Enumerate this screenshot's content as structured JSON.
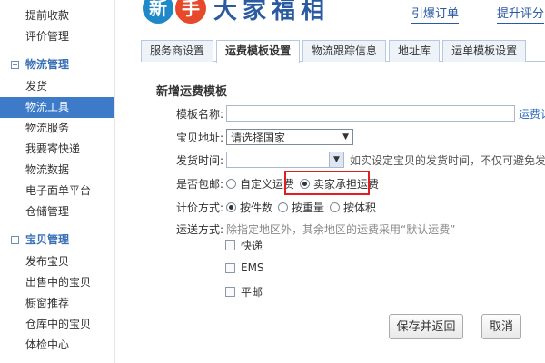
{
  "sidebar": {
    "top_items": [
      {
        "label": "提前收款"
      },
      {
        "label": "评价管理"
      }
    ],
    "groups": [
      {
        "title": "物流管理",
        "items": [
          {
            "label": "发货"
          },
          {
            "label": "物流工具",
            "active": true
          },
          {
            "label": "物流服务"
          },
          {
            "label": "我要寄快递"
          },
          {
            "label": "物流数据"
          },
          {
            "label": "电子面单平台"
          },
          {
            "label": "仓储管理"
          }
        ]
      },
      {
        "title": "宝贝管理",
        "items": [
          {
            "label": "发布宝贝"
          },
          {
            "label": "出售中的宝贝"
          },
          {
            "label": "橱窗推荐"
          },
          {
            "label": "仓库中的宝贝"
          },
          {
            "label": "体检中心"
          }
        ]
      }
    ]
  },
  "header": {
    "logo_badge_1": "新",
    "logo_badge_2": "手",
    "logo_text": "大家福相",
    "link_1": "引爆订单",
    "link_2": "提升评分"
  },
  "tabs": [
    {
      "label": "服务商设置",
      "active": false
    },
    {
      "label": "运费模板设置",
      "active": true
    },
    {
      "label": "物流跟踪信息",
      "active": false
    },
    {
      "label": "地址库",
      "active": false
    },
    {
      "label": "运单模板设置",
      "active": false
    }
  ],
  "form": {
    "title": "新增运费模板",
    "name_label": "模板名称:",
    "name_value": "",
    "name_link": "运费计",
    "address_label": "宝贝地址:",
    "address_value": "请选择国家",
    "ship_time_label": "发货时间:",
    "ship_time_value": "",
    "ship_time_hint": "如实设定宝贝的发货时间，不仅可避免发货咨",
    "free_ship_label": "是否包邮:",
    "free_ship_opt_custom": "自定义运费",
    "free_ship_opt_seller": "卖家承担运费",
    "free_ship_selected": "卖家承担运费",
    "pricing_label": "计价方式:",
    "pricing_opts": [
      "按件数",
      "按重量",
      "按体积"
    ],
    "pricing_selected": "按件数",
    "delivery_label": "运送方式:",
    "delivery_hint": "除指定地区外，其余地区的运费采用“默认运费”",
    "delivery_opts": [
      "快递",
      "EMS",
      "平邮"
    ],
    "save_button": "保存并返回",
    "cancel_button": "取消"
  },
  "colors": {
    "active_sidebar": "#3d7bc9",
    "highlight_box": "#e02020",
    "group_title": "#3a6fb5"
  }
}
